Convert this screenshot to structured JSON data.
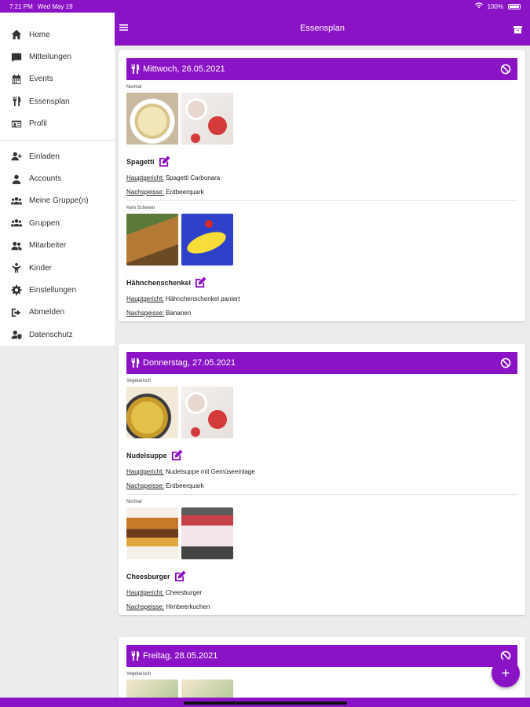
{
  "status_bar": {
    "time": "7:21 PM",
    "date": "Wed May 19",
    "battery": "100%"
  },
  "app_bar": {
    "title": "Essensplan"
  },
  "sidebar": {
    "items": [
      {
        "label": "Home",
        "icon": "home-icon"
      },
      {
        "label": "Mitteilungen",
        "icon": "message-icon"
      },
      {
        "label": "Events",
        "icon": "calendar-icon"
      },
      {
        "label": "Essensplan",
        "icon": "cutlery-icon"
      },
      {
        "label": "Profil",
        "icon": "id-card-icon"
      }
    ],
    "items2": [
      {
        "label": "Einladen",
        "icon": "user-plus-icon"
      },
      {
        "label": "Accounts",
        "icon": "user-icon"
      },
      {
        "label": "Meine Gruppe(n)",
        "icon": "users-icon"
      },
      {
        "label": "Gruppen",
        "icon": "users-icon"
      },
      {
        "label": "Mitarbeiter",
        "icon": "user-friends-icon"
      },
      {
        "label": "Kinder",
        "icon": "child-icon"
      },
      {
        "label": "Einstellungen",
        "icon": "gear-icon"
      },
      {
        "label": "Abmelden",
        "icon": "sign-out-icon"
      },
      {
        "label": "Datenschutz",
        "icon": "user-shield-icon"
      }
    ]
  },
  "days": [
    {
      "date": "Mittwoch, 26.05.2021",
      "meals": [
        {
          "category": "Normal",
          "name": "Spagetti",
          "main_label": "Hauptgericht:",
          "main": "Spagetti Carbonara",
          "dessert_label": "Nachspeisse:",
          "dessert": "Erdbeerquark"
        },
        {
          "category": "Kein Schwein",
          "name": "Hähnchenschenkel",
          "main_label": "Hauptgericht:",
          "main": "Hähnchenschenkel paniert",
          "dessert_label": "Nachspeisse:",
          "dessert": "Bananen"
        }
      ]
    },
    {
      "date": "Donnerstag, 27.05.2021",
      "meals": [
        {
          "category": "Vegetarisch",
          "name": "Nudelsuppe",
          "main_label": "Hauptgericht:",
          "main": "Nudelsuppe mit Gemüseeinlage",
          "dessert_label": "Nachspeisse:",
          "dessert": "Erdbeerquark"
        },
        {
          "category": "Normal",
          "name": "Cheesburger",
          "main_label": "Hauptgericht:",
          "main": "Cheesburger",
          "dessert_label": "Nachspeisse:",
          "dessert": "Himbeerkuchen"
        }
      ]
    },
    {
      "date": "Freitag, 28.05.2021",
      "meals": [
        {
          "category": "Vegetarisch"
        }
      ]
    }
  ],
  "fab": {
    "label": "+"
  },
  "colors": {
    "accent": "#8b13c6"
  }
}
